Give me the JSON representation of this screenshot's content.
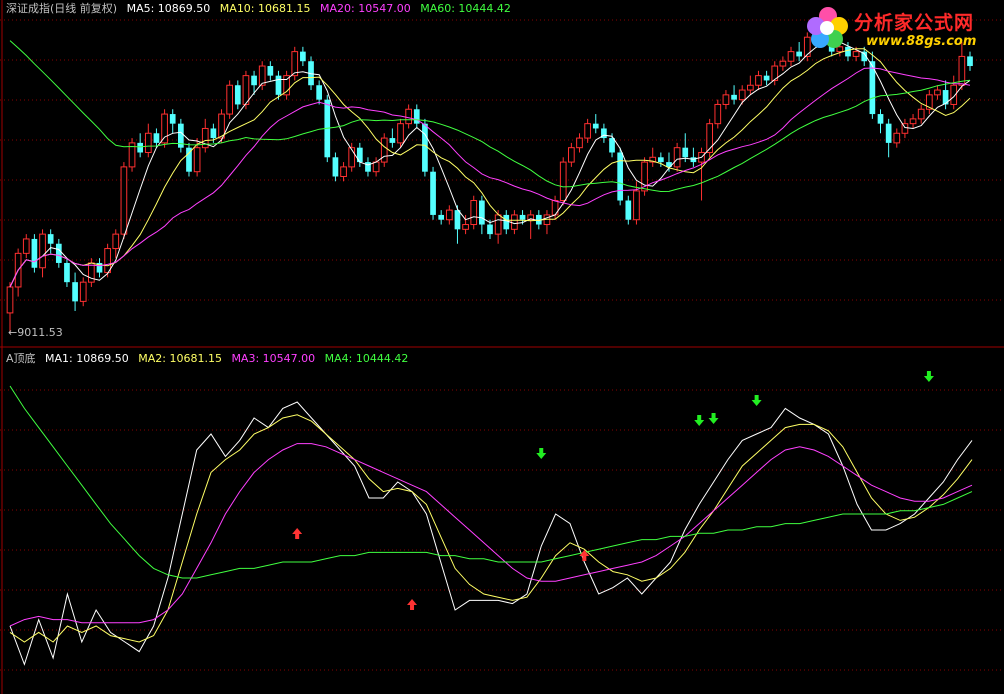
{
  "header_top": {
    "title": "深证成指(日线 前复权)",
    "ma5": "MA5: 10869.50",
    "ma10": "MA10: 10681.15",
    "ma20": "MA20: 10547.00",
    "ma60": "MA60: 10444.42"
  },
  "header_bottom": {
    "title": "A顶底",
    "ma1": "MA1: 10869.50",
    "ma2": "MA2: 10681.15",
    "ma3": "MA3: 10547.00",
    "ma4": "MA4: 10444.42"
  },
  "low_label": "←9011.53",
  "logo": {
    "text": "分析家公式网",
    "url": "www.88gs.com"
  },
  "colors": {
    "up": "#ff3030",
    "down": "#54ffff",
    "ma5": "#ffffff",
    "ma10": "#ffff66",
    "ma20": "#ff40ff",
    "ma60": "#40ff40",
    "grid": "#8b0000",
    "arrow_up": "#ff3333",
    "arrow_down": "#22ee22"
  },
  "chart_data": [
    {
      "type": "candlestick",
      "title": "深证成指(日线 前复权)",
      "ylim": [
        9000,
        12300
      ],
      "low_marker": 9011.53,
      "candles": [
        [
          9230,
          9500,
          9011,
          9550
        ],
        [
          9500,
          9850,
          9400,
          9900
        ],
        [
          9850,
          10000,
          9800,
          10050
        ],
        [
          10000,
          9700,
          9650,
          10050
        ],
        [
          9700,
          10050,
          9600,
          10100
        ],
        [
          10050,
          9950,
          9850,
          10100
        ],
        [
          9950,
          9750,
          9700,
          10000
        ],
        [
          9750,
          9550,
          9500,
          9800
        ],
        [
          9550,
          9350,
          9250,
          9650
        ],
        [
          9350,
          9550,
          9300,
          9600
        ],
        [
          9550,
          9750,
          9500,
          9800
        ],
        [
          9750,
          9650,
          9600,
          9800
        ],
        [
          9650,
          9900,
          9600,
          9950
        ],
        [
          9900,
          10050,
          9800,
          10100
        ],
        [
          10050,
          10750,
          10000,
          10800
        ],
        [
          10750,
          11000,
          10700,
          11050
        ],
        [
          11000,
          10900,
          10850,
          11100
        ],
        [
          10900,
          11100,
          10850,
          11200
        ],
        [
          11100,
          11000,
          10950,
          11150
        ],
        [
          11000,
          11300,
          10950,
          11350
        ],
        [
          11300,
          11200,
          11100,
          11350
        ],
        [
          11200,
          10950,
          10900,
          11250
        ],
        [
          10950,
          10700,
          10650,
          11000
        ],
        [
          10700,
          10950,
          10650,
          11050
        ],
        [
          10950,
          11150,
          10900,
          11250
        ],
        [
          11150,
          11050,
          11000,
          11200
        ],
        [
          11050,
          11300,
          11000,
          11350
        ],
        [
          11300,
          11600,
          11250,
          11650
        ],
        [
          11600,
          11400,
          11350,
          11650
        ],
        [
          11400,
          11700,
          11350,
          11750
        ],
        [
          11700,
          11600,
          11500,
          11750
        ],
        [
          11600,
          11800,
          11550,
          11850
        ],
        [
          11800,
          11700,
          11650,
          11850
        ],
        [
          11700,
          11500,
          11450,
          11750
        ],
        [
          11500,
          11700,
          11450,
          11750
        ],
        [
          11700,
          11950,
          11650,
          12000
        ],
        [
          11950,
          11850,
          11800,
          12000
        ],
        [
          11850,
          11600,
          11550,
          11900
        ],
        [
          11600,
          11450,
          11400,
          11650
        ],
        [
          11450,
          10850,
          10800,
          11500
        ],
        [
          10850,
          10650,
          10600,
          10900
        ],
        [
          10650,
          10750,
          10600,
          10800
        ],
        [
          10750,
          10950,
          10700,
          11000
        ],
        [
          10950,
          10800,
          10750,
          11000
        ],
        [
          10800,
          10700,
          10650,
          10850
        ],
        [
          10700,
          10800,
          10650,
          10850
        ],
        [
          10800,
          11050,
          10750,
          11100
        ],
        [
          11050,
          11000,
          10950,
          11150
        ],
        [
          11000,
          11200,
          10950,
          11250
        ],
        [
          11200,
          11350,
          11150,
          11400
        ],
        [
          11350,
          11200,
          11150,
          11400
        ],
        [
          11200,
          10700,
          10650,
          11250
        ],
        [
          10700,
          10250,
          10200,
          10750
        ],
        [
          10250,
          10200,
          10150,
          10300
        ],
        [
          10200,
          10300,
          10150,
          10350
        ],
        [
          10300,
          10100,
          9950,
          10350
        ],
        [
          10100,
          10150,
          10050,
          10250
        ],
        [
          10150,
          10400,
          10100,
          10450
        ],
        [
          10400,
          10150,
          10050,
          10450
        ],
        [
          10150,
          10050,
          10000,
          10200
        ],
        [
          10050,
          10250,
          9950,
          10300
        ],
        [
          10250,
          10100,
          10050,
          10300
        ],
        [
          10100,
          10250,
          10050,
          10300
        ],
        [
          10250,
          10200,
          10150,
          10300
        ],
        [
          10200,
          10250,
          10000,
          10300
        ],
        [
          10250,
          10150,
          10100,
          10300
        ],
        [
          10150,
          10250,
          10050,
          10300
        ],
        [
          10250,
          10400,
          10200,
          10450
        ],
        [
          10400,
          10800,
          10350,
          10850
        ],
        [
          10800,
          10950,
          10750,
          11000
        ],
        [
          10950,
          11050,
          10900,
          11100
        ],
        [
          11050,
          11200,
          11000,
          11250
        ],
        [
          11200,
          11150,
          11100,
          11300
        ],
        [
          11150,
          11050,
          11000,
          11200
        ],
        [
          11050,
          10900,
          10850,
          11100
        ],
        [
          10900,
          10400,
          10350,
          10950
        ],
        [
          10400,
          10200,
          10150,
          10450
        ],
        [
          10200,
          10500,
          10150,
          10600
        ],
        [
          10500,
          10800,
          10450,
          10850
        ],
        [
          10800,
          10850,
          10750,
          10950
        ],
        [
          10850,
          10800,
          10750,
          10900
        ],
        [
          10800,
          10750,
          10700,
          10900
        ],
        [
          10750,
          10950,
          10700,
          11000
        ],
        [
          10950,
          10850,
          10800,
          11100
        ],
        [
          10850,
          10800,
          10750,
          10950
        ],
        [
          10800,
          10900,
          10400,
          10950
        ],
        [
          10900,
          11200,
          10850,
          11250
        ],
        [
          11200,
          11400,
          11150,
          11450
        ],
        [
          11400,
          11500,
          11350,
          11550
        ],
        [
          11500,
          11450,
          11400,
          11600
        ],
        [
          11450,
          11550,
          11400,
          11600
        ],
        [
          11550,
          11600,
          11500,
          11700
        ],
        [
          11600,
          11700,
          11550,
          11750
        ],
        [
          11700,
          11650,
          11600,
          11750
        ],
        [
          11650,
          11800,
          11600,
          11850
        ],
        [
          11800,
          11850,
          11750,
          11900
        ],
        [
          11850,
          11950,
          11800,
          12000
        ],
        [
          11950,
          11900,
          11850,
          12050
        ],
        [
          11900,
          12100,
          11850,
          12150
        ],
        [
          12100,
          12150,
          12050,
          12200
        ],
        [
          12150,
          12050,
          12000,
          12200
        ],
        [
          12050,
          11950,
          11900,
          12100
        ],
        [
          11950,
          12000,
          11900,
          12050
        ],
        [
          12000,
          11900,
          11850,
          12050
        ],
        [
          11900,
          11950,
          11850,
          12000
        ],
        [
          11950,
          11850,
          11800,
          12000
        ],
        [
          11850,
          11300,
          11250,
          11950
        ],
        [
          11300,
          11200,
          11100,
          11350
        ],
        [
          11200,
          11000,
          10850,
          11250
        ],
        [
          11000,
          11100,
          10950,
          11150
        ],
        [
          11100,
          11200,
          11050,
          11250
        ],
        [
          11200,
          11250,
          11150,
          11300
        ],
        [
          11250,
          11350,
          11200,
          11400
        ],
        [
          11350,
          11500,
          11300,
          11550
        ],
        [
          11500,
          11550,
          11450,
          11600
        ],
        [
          11550,
          11400,
          11350,
          11650
        ],
        [
          11400,
          11600,
          11350,
          11700
        ],
        [
          11600,
          11900,
          11550,
          12050
        ],
        [
          11900,
          11800,
          11750,
          11950
        ]
      ]
    },
    {
      "type": "line",
      "title": "A顶底",
      "ylim": [
        0,
        100
      ],
      "series_names": [
        "MA1",
        "MA2",
        "MA3",
        "MA4"
      ],
      "series": [
        {
          "name": "MA1",
          "values": [
            20,
            8,
            22,
            10,
            30,
            15,
            25,
            18,
            15,
            12,
            20,
            35,
            55,
            75,
            80,
            73,
            78,
            85,
            82,
            88,
            90,
            85,
            80,
            75,
            70,
            60,
            60,
            65,
            62,
            55,
            40,
            25,
            28,
            28,
            28,
            27,
            30,
            45,
            55,
            52,
            40,
            30,
            32,
            35,
            30,
            35,
            40,
            50,
            58,
            65,
            72,
            78,
            80,
            82,
            88,
            85,
            83,
            80,
            70,
            58,
            50,
            50,
            52,
            55,
            60,
            65,
            72,
            78
          ]
        },
        {
          "name": "MA2",
          "values": [
            18,
            15,
            18,
            15,
            20,
            18,
            20,
            17,
            16,
            15,
            17,
            25,
            40,
            55,
            68,
            72,
            75,
            80,
            82,
            85,
            86,
            84,
            80,
            76,
            72,
            66,
            62,
            63,
            62,
            58,
            48,
            38,
            33,
            30,
            29,
            28,
            29,
            35,
            42,
            46,
            44,
            40,
            37,
            36,
            34,
            35,
            38,
            43,
            50,
            56,
            63,
            70,
            74,
            78,
            82,
            83,
            83,
            81,
            76,
            68,
            60,
            55,
            53,
            54,
            57,
            61,
            66,
            72
          ]
        },
        {
          "name": "MA3",
          "values": [
            20,
            22,
            23,
            22,
            22,
            21,
            21,
            21,
            21,
            21,
            22,
            25,
            30,
            38,
            46,
            55,
            62,
            68,
            72,
            75,
            77,
            77,
            76,
            74,
            72,
            70,
            68,
            66,
            64,
            62,
            58,
            54,
            50,
            46,
            42,
            38,
            35,
            34,
            34,
            35,
            36,
            37,
            38,
            39,
            40,
            42,
            45,
            48,
            52,
            56,
            60,
            64,
            68,
            72,
            75,
            76,
            75,
            73,
            70,
            67,
            64,
            62,
            60,
            59,
            59,
            60,
            62,
            64
          ]
        },
        {
          "name": "MA4",
          "values": [
            95,
            88,
            82,
            76,
            70,
            64,
            58,
            52,
            47,
            42,
            38,
            36,
            35,
            35,
            36,
            37,
            38,
            38,
            39,
            40,
            40,
            40,
            41,
            42,
            42,
            43,
            43,
            43,
            43,
            43,
            42,
            42,
            41,
            41,
            40,
            40,
            40,
            40,
            41,
            42,
            43,
            44,
            45,
            46,
            47,
            47,
            48,
            48,
            49,
            49,
            50,
            50,
            51,
            51,
            52,
            52,
            53,
            54,
            55,
            55,
            55,
            55,
            56,
            56,
            57,
            58,
            60,
            62
          ]
        }
      ],
      "up_arrows_at": [
        20,
        28,
        40
      ],
      "down_arrows_at": [
        37,
        48,
        49,
        52,
        64
      ]
    }
  ]
}
